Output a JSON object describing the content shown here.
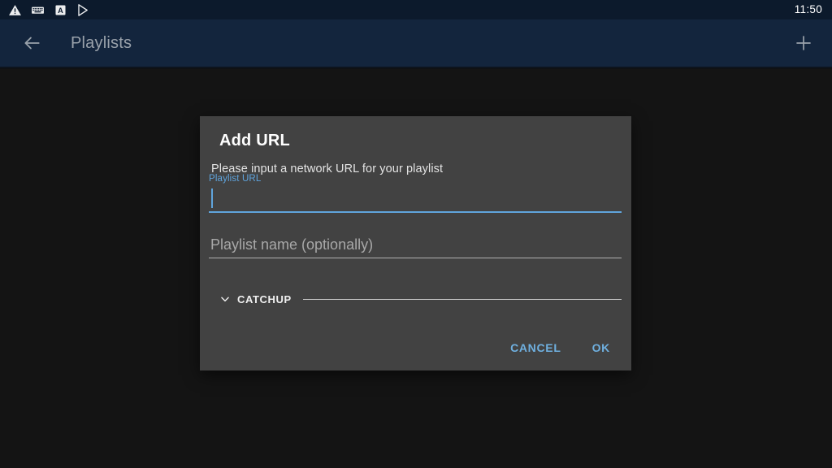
{
  "status_bar": {
    "icons": [
      {
        "name": "warning-triangle-icon",
        "label": "warning"
      },
      {
        "name": "keyboard-icon",
        "label": "keyboard"
      },
      {
        "name": "font-a-icon",
        "label": "A"
      },
      {
        "name": "play-store-icon",
        "label": "play"
      }
    ],
    "clock": "11:50",
    "background": "#0c1a2c"
  },
  "app_bar": {
    "back_icon": "arrow-left-icon",
    "title": "Playlists",
    "add_icon": "plus-icon",
    "background": "#13253d",
    "title_color": "#9aa2ab"
  },
  "dialog": {
    "title": "Add URL",
    "message": "Please input a network URL for your playlist",
    "background": "#424242",
    "accent_color": "#60a5dd",
    "url_field": {
      "label": "Playlist URL",
      "value": "",
      "placeholder": "",
      "focused": true,
      "underline_color": "#60a5dd"
    },
    "name_field": {
      "value": "",
      "placeholder": "Playlist name (optionally)",
      "focused": false,
      "underline_color": "#b0b0b0"
    },
    "catchup_section": {
      "label": "CATCHUP",
      "chevron_icon": "chevron-down-icon",
      "expanded": false
    },
    "actions": {
      "cancel_label": "CANCEL",
      "ok_label": "OK",
      "button_color": "#6fb0e0"
    }
  },
  "page": {
    "background": "#141414"
  }
}
